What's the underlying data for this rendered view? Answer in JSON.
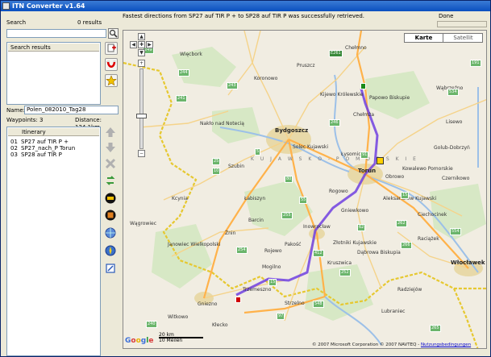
{
  "window": {
    "title": "ITN Converter v1.64"
  },
  "search": {
    "label": "Search",
    "result_count": "0 results",
    "value": "",
    "results_header": "Search results"
  },
  "route": {
    "name_label": "Name:",
    "name_value": "Polen_082010_Tag28",
    "waypoints": "Waypoints: 3",
    "distance": "Distance: 124.1km"
  },
  "itinerary": {
    "header": "Itinerary",
    "items": [
      {
        "num": "01",
        "label": "SP27 auf TIR P +"
      },
      {
        "num": "02",
        "label": "SP27_nach_P Torun"
      },
      {
        "num": "03",
        "label": "SP28 auf TIR P"
      }
    ]
  },
  "status": {
    "message": "Fastest directions from SP27 auf TIR P + to SP28 auf TIR P was successfully retrieved.",
    "done": "Done"
  },
  "map": {
    "type_map": "Karte",
    "type_satellite": "Satellit",
    "region_label": "K U J A W S K O - P O M O R S K I E",
    "towns": [
      {
        "label": "Bydgoszcz",
        "big": true
      },
      {
        "label": "Torun",
        "big": true
      },
      {
        "label": "Inowrocław",
        "big": false
      },
      {
        "label": "Włocławek",
        "big": true
      },
      {
        "label": "Gniezno",
        "big": false
      },
      {
        "label": "Chełmno",
        "big": false
      },
      {
        "label": "Nakło nad Notecią",
        "big": false
      },
      {
        "label": "Wągrowiec",
        "big": false
      },
      {
        "label": "Mogilno",
        "big": false
      },
      {
        "label": "Kruszwica",
        "big": false
      },
      {
        "label": "Aleksandrów Kujawski",
        "big": false
      },
      {
        "label": "Golub-Dobrzyń",
        "big": false
      },
      {
        "label": "Wąbrzeźno",
        "big": false
      },
      {
        "label": "Szubin",
        "big": false
      },
      {
        "label": "Trzemeszno",
        "big": false
      },
      {
        "label": "Chełmża",
        "big": false
      },
      {
        "label": "Ciechocinek",
        "big": false
      },
      {
        "label": "Solec Kujawski",
        "big": false
      },
      {
        "label": "Koronowo",
        "big": false
      },
      {
        "label": "Więcbork",
        "big": false
      },
      {
        "label": "Żnin",
        "big": false
      },
      {
        "label": "Barcin",
        "big": false
      },
      {
        "label": "Łabiszyn",
        "big": false
      },
      {
        "label": "Kcynia",
        "big": false
      },
      {
        "label": "Janowiec Wielkopolski",
        "big": false
      },
      {
        "label": "Pakość",
        "big": false
      },
      {
        "label": "Strzelno",
        "big": false
      },
      {
        "label": "Radziejów",
        "big": false
      },
      {
        "label": "Kłecko",
        "big": false
      },
      {
        "label": "Witkowo",
        "big": false
      },
      {
        "label": "Kowalewo Pomorskie",
        "big": false
      },
      {
        "label": "Kijewo Królewskie",
        "big": false
      },
      {
        "label": "Papowo Biskupie",
        "big": false
      },
      {
        "label": "Rogowo",
        "big": false
      },
      {
        "label": "Gniewkowo",
        "big": false
      },
      {
        "label": "Raciążek",
        "big": false
      },
      {
        "label": "Lubraniec",
        "big": false
      },
      {
        "label": "Złotniki Kujawskie",
        "big": false
      },
      {
        "label": "Rojewo",
        "big": false
      },
      {
        "label": "Dąbrowa Biskupia",
        "big": false
      },
      {
        "label": "Łysomice",
        "big": false
      },
      {
        "label": "Obrowo",
        "big": false
      },
      {
        "label": "Czernikowo",
        "big": false
      },
      {
        "label": "Lisewo",
        "big": false
      },
      {
        "label": "Pruszcz",
        "big": false
      }
    ],
    "roads": [
      "E261",
      "5",
      "25",
      "15",
      "10",
      "91",
      "80",
      "55",
      "62",
      "243",
      "241",
      "244",
      "246",
      "254",
      "262",
      "266",
      "252",
      "412",
      "15",
      "534",
      "554",
      "548",
      "97",
      "265",
      "255",
      "249",
      "191",
      "240"
    ],
    "scale_km": "20 km",
    "scale_mi": "10 Meilen",
    "google": "Google",
    "copyright": "© 2007 Microsoft Corporation © 2007 NAVTEQ -",
    "terms": "Nutzungsbedingungen"
  },
  "colors": {
    "route": "#7040e0",
    "green_road": "#6bb56b",
    "boundary": "#e6c830",
    "map_bg": "#f1ede2"
  }
}
